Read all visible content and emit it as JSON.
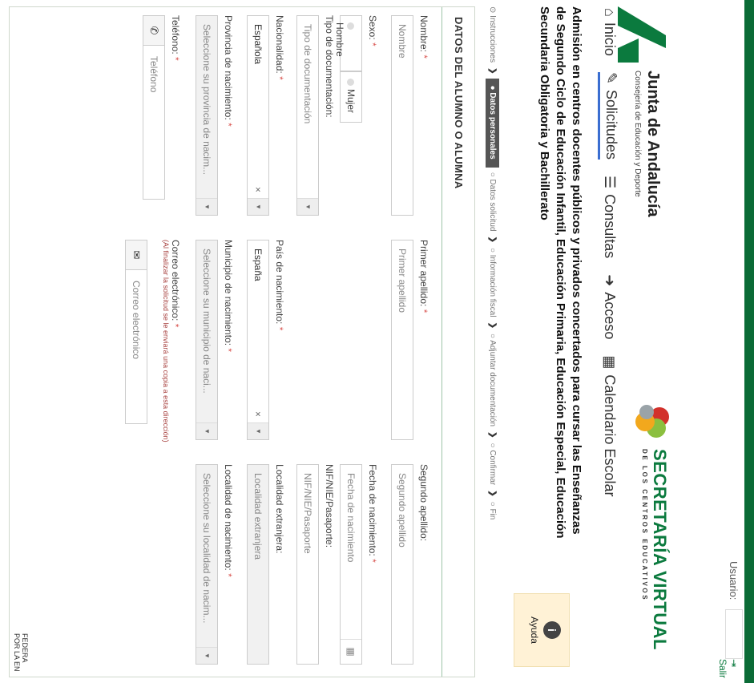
{
  "header": {
    "usuario_label": "Usuario:",
    "salir_label": "Salir",
    "brand_title": "Junta de Andalucía",
    "brand_subtitle": "Consejería de Educación y Deporte",
    "sv_title": "SECRETARÍA VIRTUAL",
    "sv_subtitle": "DE LOS CENTROS EDUCATIVOS"
  },
  "nav": {
    "items": [
      {
        "label": "Inicio",
        "icon": "home-icon"
      },
      {
        "label": "Solicitudes",
        "icon": "pencil-icon"
      },
      {
        "label": "Consultas",
        "icon": "list-icon"
      },
      {
        "label": "Acceso",
        "icon": "login-icon"
      },
      {
        "label": "Calendario Escolar",
        "icon": "calendar-icon"
      }
    ],
    "active": "Solicitudes"
  },
  "page": {
    "title": "Admisión en centros docentes públicos y privados concertados para cursar las Enseñanzas de Segundo Ciclo de Educación Infantil, Educación Primaria, Educación Especial, Educación Secundaria Obligatoria y Bachillerato",
    "help_label": "Ayuda"
  },
  "steps": [
    {
      "label": "Instrucciones",
      "state": "done"
    },
    {
      "label": "Datos personales",
      "state": "active"
    },
    {
      "label": "Datos solicitud",
      "state": "pending"
    },
    {
      "label": "Información fiscal",
      "state": "pending"
    },
    {
      "label": "Adjuntar documentación",
      "state": "pending"
    },
    {
      "label": "Confirmar",
      "state": "pending"
    },
    {
      "label": "Fin",
      "state": "pending"
    }
  ],
  "form": {
    "section_title": "DATOS DEL ALUMNO O ALUMNA",
    "nombre": {
      "label": "Nombre:",
      "placeholder": "Nombre"
    },
    "apellido1": {
      "label": "Primer apellido:",
      "placeholder": "Primer apellido"
    },
    "apellido2": {
      "label": "Segundo apellido:",
      "placeholder": "Segundo apellido"
    },
    "sexo": {
      "label": "Sexo:",
      "options": [
        "Hombre",
        "Mujer"
      ]
    },
    "fecha": {
      "label": "Fecha de nacimiento:",
      "placeholder": "Fecha de nacimiento"
    },
    "tipo_doc": {
      "label": "Tipo de documentación:",
      "placeholder": "Tipo de documentación"
    },
    "nif": {
      "label": "NIF/NIE/Pasaporte:",
      "placeholder": "NIF/NIE/Pasaporte"
    },
    "nacionalidad": {
      "label": "Nacionalidad:",
      "value": "Española"
    },
    "pais": {
      "label": "País de nacimiento:",
      "value": "España"
    },
    "localidad_ext": {
      "label": "Localidad extranjera:",
      "placeholder": "Localidad extranjera"
    },
    "provincia": {
      "label": "Provincia de nacimiento:",
      "placeholder": "Seleccione su provincia de nacim..."
    },
    "municipio": {
      "label": "Municipio de nacimiento:",
      "placeholder": "Seleccione su municipio de naci..."
    },
    "localidad": {
      "label": "Localidad de nacimiento:",
      "placeholder": "Seleccione su localidad de nacim..."
    },
    "telefono": {
      "label": "Teléfono:",
      "placeholder": "Teléfono"
    },
    "correo": {
      "label": "Correo electrónico:",
      "note": "(Al finalizar la solicitud se le enviará una copia a esta dirección)",
      "placeholder": "Correo electrónico"
    }
  },
  "footer": {
    "fed_line1": "FEDERA",
    "fed_line2": "POR LA EN"
  },
  "colors": {
    "green": "#0b7a3e",
    "accent_blue": "#3a6ed1",
    "required": "#d9534f"
  }
}
